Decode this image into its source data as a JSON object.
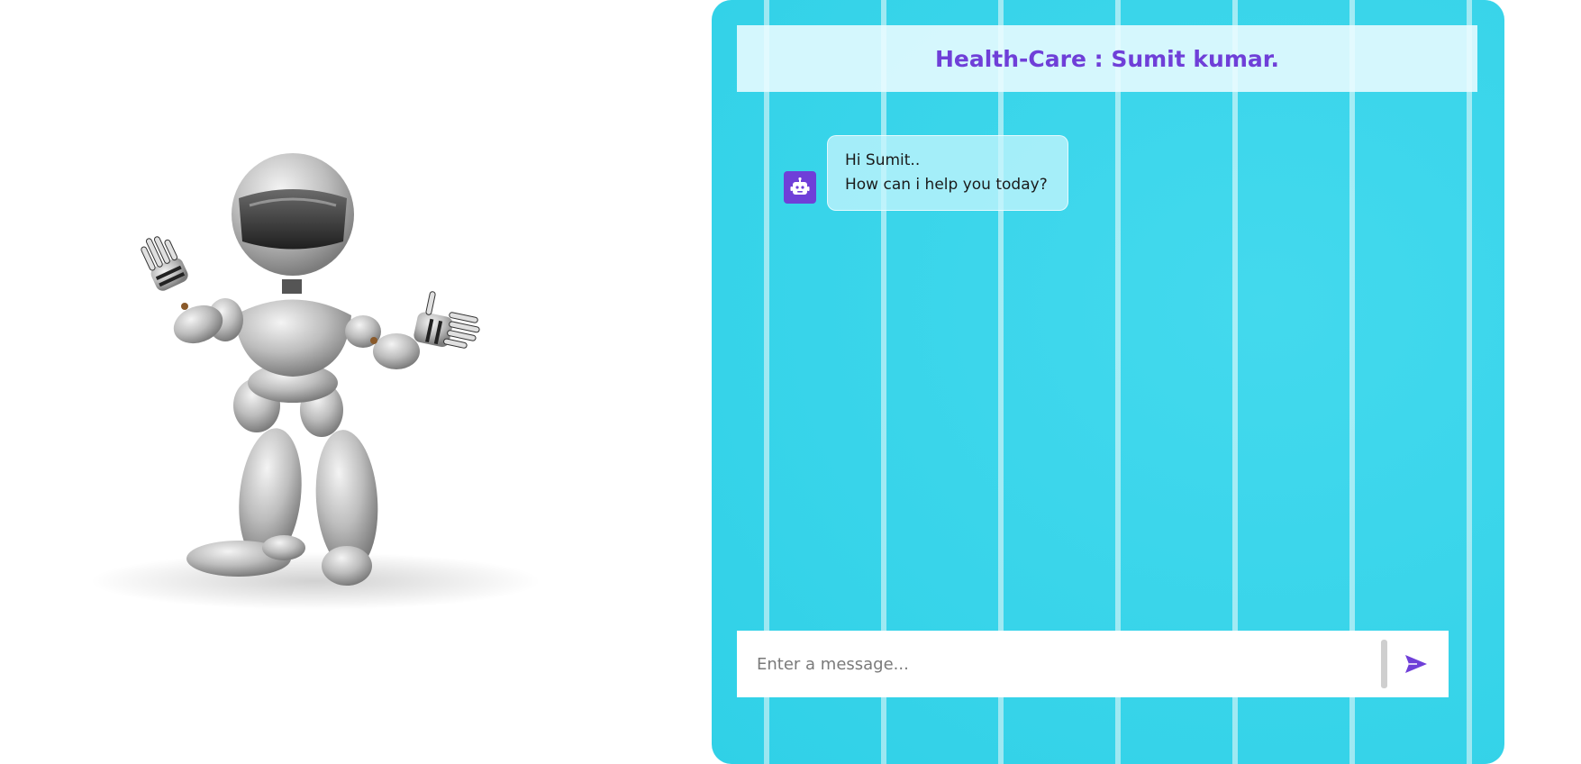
{
  "chat": {
    "title": "Health-Care : Sumit kumar.",
    "messages": [
      {
        "sender": "bot",
        "avatar_icon": "robot-icon",
        "lines": [
          "Hi Sumit..",
          "How can i help you today?"
        ]
      }
    ],
    "composer": {
      "placeholder": "Enter a message...",
      "send_icon": "send-icon"
    }
  },
  "colors": {
    "accent": "#6f3fd8",
    "panel_background": "#33d6ec",
    "header_background": "#ebfcff"
  }
}
